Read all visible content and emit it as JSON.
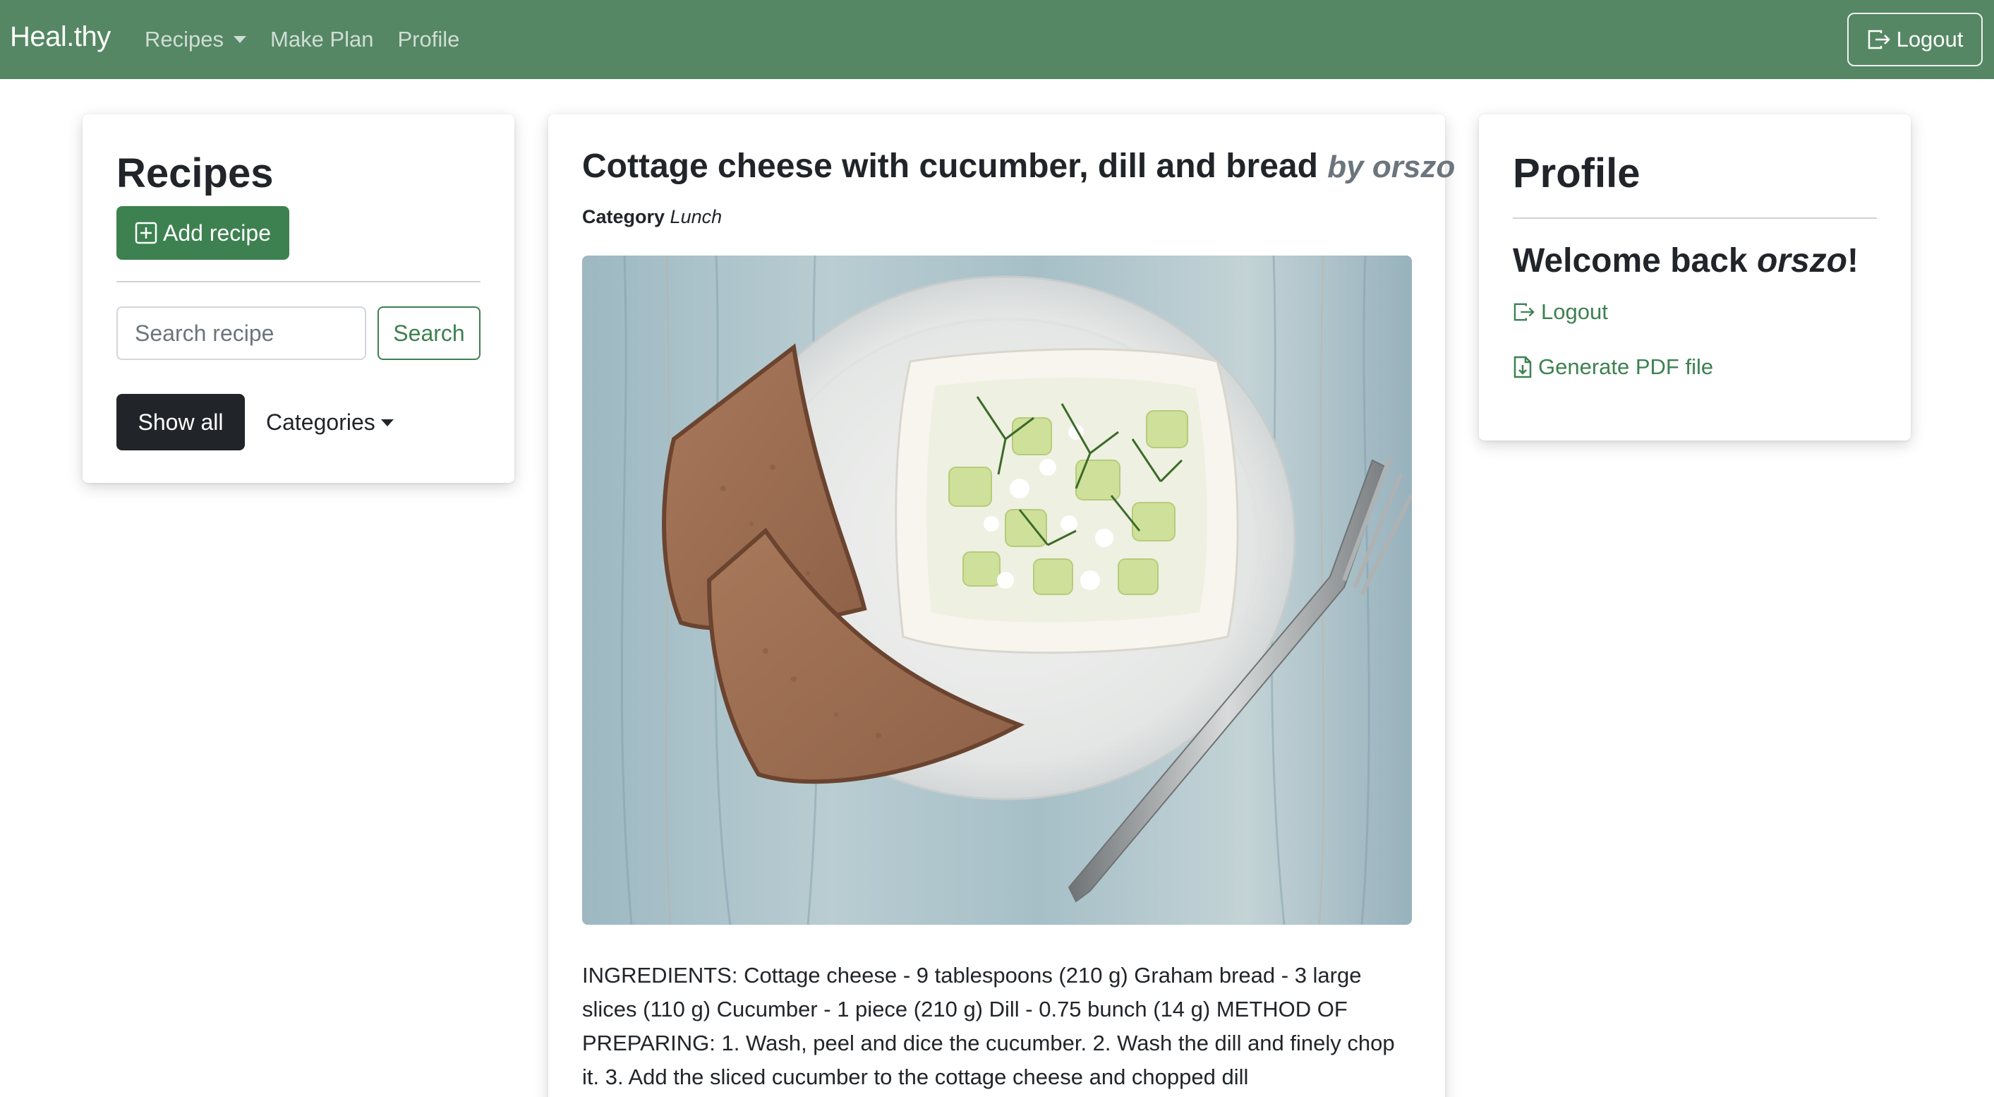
{
  "navbar": {
    "brand": "Heal.thy",
    "links": [
      "Recipes",
      "Make Plan",
      "Profile"
    ],
    "logout_label": "Logout",
    "background": "#558764"
  },
  "recipes_panel": {
    "title": "Recipes",
    "add_label": "Add recipe",
    "search_placeholder": "Search recipe",
    "search_label": "Search",
    "show_all_label": "Show all",
    "categories_label": "Categories"
  },
  "recipe": {
    "title": "Cottage cheese with cucumber, dill and bread",
    "author_prefix": "by",
    "author": "orszo",
    "category_label": "Category",
    "category": "Lunch",
    "image_alt_icon": "food-photo",
    "description": "INGREDIENTS: Cottage cheese - 9 tablespoons (210 g) Graham bread - 3 large slices (110 g) Cucumber - 1 piece (210 g) Dill - 0.75 bunch (14 g) METHOD OF PREPARING: 1. Wash, peel and dice the cucumber. 2. Wash the dill and finely chop it. 3. Add the sliced cucumber to the cottage cheese and chopped dill"
  },
  "profile_panel": {
    "title": "Profile",
    "welcome_prefix": "Welcome back ",
    "username": "orszo",
    "welcome_suffix": "!",
    "logout_label": "Logout",
    "pdf_label": "Generate PDF file"
  },
  "colors": {
    "accent": "#3d8150",
    "dark": "#212529"
  }
}
